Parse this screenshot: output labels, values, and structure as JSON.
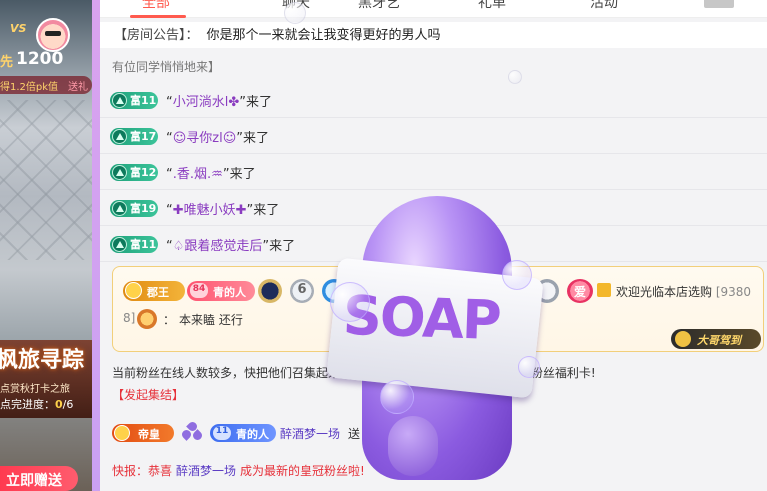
{
  "video": {
    "vs_text": "VS",
    "pk_prefix": "先",
    "pk_score": "1200",
    "pk_multiplier": "得1.2倍pk值",
    "pk_send": "送礼",
    "promo_title": "枫旅寻踪",
    "promo_sub": "点赏秋打卡之旅",
    "promo_progress_label": "点完进度：",
    "promo_progress_current": "0",
    "promo_progress_total": "/6",
    "gift_button": "立即赠送"
  },
  "tabs": [
    {
      "label": "全部",
      "active": true
    },
    {
      "label": "聊天",
      "active": false
    },
    {
      "label": "黑牙艺",
      "active": false
    },
    {
      "label": "礼单",
      "active": false
    },
    {
      "label": "活动",
      "active": false
    }
  ],
  "announcement": {
    "label": "【房间公告】：",
    "text": "你是那个一来就会让我变得更好的男人吗"
  },
  "cut_line": "有位同学悄悄地来】",
  "join_messages": [
    {
      "badge": "富11",
      "nick": "小河淌水l✤",
      "suffix": "来了"
    },
    {
      "badge": "富17",
      "nick": "☺寻你zl☺",
      "suffix": "来了"
    },
    {
      "badge": "富12",
      "nick": ".香.烟.♒",
      "suffix": "来了"
    },
    {
      "badge": "富19",
      "nick": "✚唯魅小妖✚",
      "suffix": "来了"
    },
    {
      "badge": "富11",
      "nick": "♤跟着感觉走后",
      "suffix": "来了"
    }
  ],
  "vip_card": {
    "title_badge": "郡王",
    "fan_level": "84",
    "fan_name": "青的人",
    "medal_six": "6",
    "medal_love": "爱",
    "welcome": "欢迎光临本店选购",
    "id_head": "[9380",
    "id_tail": "8]",
    "speaker_colon": "：",
    "speech": "本来瞌 还行",
    "big_brother": "大哥驾到"
  },
  "rally": {
    "text": "当前粉丝在线人数较多，快把他们召集起来吧，成功召集后有概率获得500六币粉丝福利卡!",
    "link": "【发起集结】"
  },
  "gift_row": {
    "title_badge": "帝皇",
    "fan_level": "11",
    "fan_name": "青的人",
    "user": "醉酒梦一场",
    "action": "送"
  },
  "news": {
    "prefix": "快报：恭喜",
    "who": "醉酒梦一场",
    "rest": "成为最新的皇冠粉丝啦!"
  },
  "soap": {
    "label": "SOAP"
  }
}
